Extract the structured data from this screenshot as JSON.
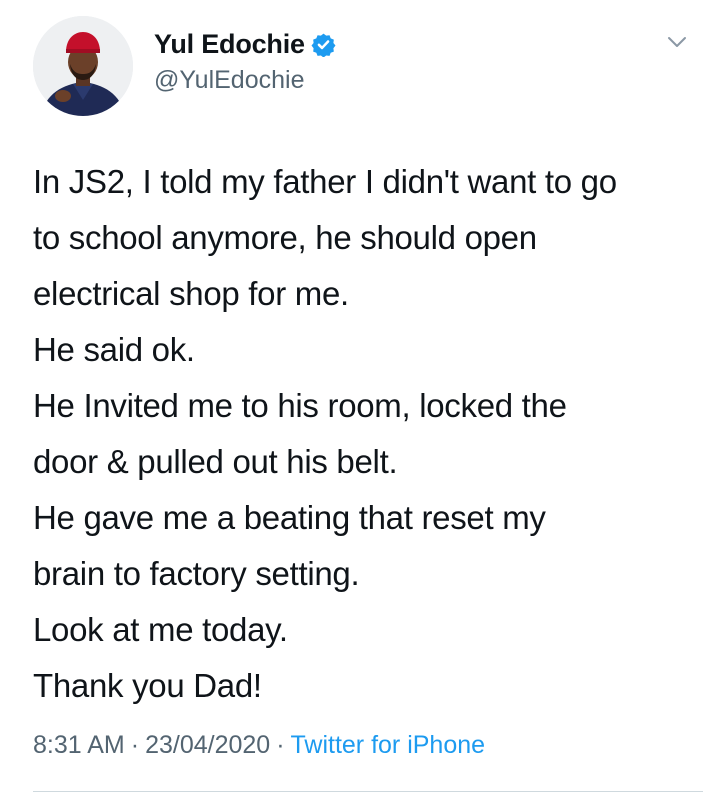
{
  "author": {
    "display_name": "Yul Edochie",
    "handle": "@YulEdochie",
    "verified": true
  },
  "tweet": {
    "lines": [
      "In JS2, I told my father I didn't want to go",
      "to school anymore, he should open",
      "electrical shop for me.",
      "He said ok.",
      "He Invited me to his room, locked the",
      "door & pulled out his belt.",
      "He gave me a beating that reset my",
      "brain to factory setting.",
      "Look at me today.",
      "Thank you Dad!"
    ]
  },
  "meta": {
    "time": "8:31 AM",
    "separator": "·",
    "date": "23/04/2020",
    "source": "Twitter for iPhone"
  },
  "colors": {
    "text": "#0f1419",
    "secondary": "#536471",
    "accent": "#1d9bf0",
    "verified_badge": "#1d9bf0"
  },
  "icons": {
    "verified": "verified-badge-icon",
    "menu": "chevron-down-icon"
  }
}
